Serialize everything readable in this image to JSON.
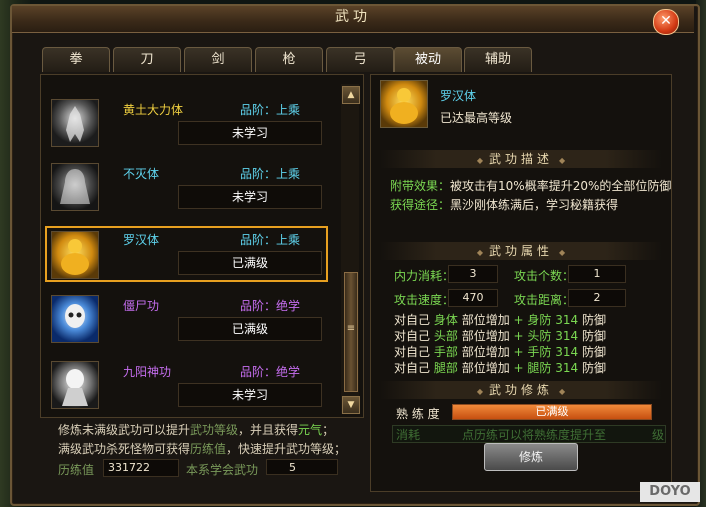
{
  "window": {
    "title": "武功",
    "close_label": "✕"
  },
  "tabs": [
    "拳",
    "刀",
    "剑",
    "枪",
    "弓",
    "被动",
    "辅助"
  ],
  "active_tab": "被动",
  "skills": [
    {
      "name": "黄土大力体",
      "grade": "品阶：上乘",
      "status": "未学习",
      "icon": "warrior-stance-icon",
      "grade_color": "blue"
    },
    {
      "name": "不灭体",
      "grade": "品阶：上乘",
      "status": "未学习",
      "icon": "ghost-figure-icon",
      "grade_color": "blue"
    },
    {
      "name": "罗汉体",
      "grade": "品阶：上乘",
      "status": "已满级",
      "icon": "golden-buddha-icon",
      "grade_color": "blue",
      "selected": true
    },
    {
      "name": "僵尸功",
      "grade": "品阶：绝学",
      "status": "已满级",
      "icon": "zombie-skull-icon",
      "grade_color": "purple"
    },
    {
      "name": "九阳神功",
      "grade": "品阶：绝学",
      "status": "未学习",
      "icon": "skeleton-mage-icon",
      "grade_color": "purple"
    }
  ],
  "scroll": {
    "up": "▲",
    "down": "▼",
    "grip": "≡"
  },
  "footer": {
    "line1_a": "修炼未满级武功可以提升",
    "line1_b": "武功等级",
    "line1_c": "，并且获得",
    "line1_d": "元气",
    "line1_e": "；",
    "line2_a": "满级武功杀死怪物可获得",
    "line2_b": "历练值",
    "line2_c": "，快速提升武功等级；",
    "exp_label": "历练值",
    "exp_value": "331722",
    "learned_label": "本系学会武功",
    "learned_value": "5"
  },
  "detail": {
    "name": "罗汉体",
    "level_text": "已达最高等级",
    "desc_header": "武功描述",
    "effect_label": "附带效果：",
    "effect_text": "被攻击有10%概率提升20%的全部位防御",
    "source_label": "获得途径：",
    "source_text": "黑沙刚体练满后，学习秘籍获得",
    "attr_header": "武功属性",
    "mp_label": "内力消耗：",
    "mp_value": "3",
    "targets_label": "攻击个数：",
    "targets_value": "1",
    "speed_label": "攻击速度：",
    "speed_value": "470",
    "range_label": "攻击距离：",
    "range_value": "2",
    "buffs": [
      {
        "prefix": "对自己",
        "part": "身体",
        "mid": "部位增加",
        "plus": "+",
        "part2": "身防",
        "value": "314",
        "suffix": "防御"
      },
      {
        "prefix": "对自己",
        "part": "头部",
        "mid": "部位增加",
        "plus": "+",
        "part2": "头防",
        "value": "314",
        "suffix": "防御"
      },
      {
        "prefix": "对自己",
        "part": "手部",
        "mid": "部位增加",
        "plus": "+",
        "part2": "手防",
        "value": "314",
        "suffix": "防御"
      },
      {
        "prefix": "对自己",
        "part": "腿部",
        "mid": "部位增加",
        "plus": "+",
        "part2": "腿防",
        "value": "314",
        "suffix": "防御"
      }
    ],
    "train_header": "武功修炼",
    "proficiency_label": "熟 练 度",
    "proficiency_text": "已满级",
    "proficiency_fraction": 1.0,
    "consume_label": "消耗",
    "consume_hint": "点历练可以将熟练度提升至",
    "consume_unit": "级",
    "train_button": "修炼"
  },
  "watermark": "DOYO"
}
